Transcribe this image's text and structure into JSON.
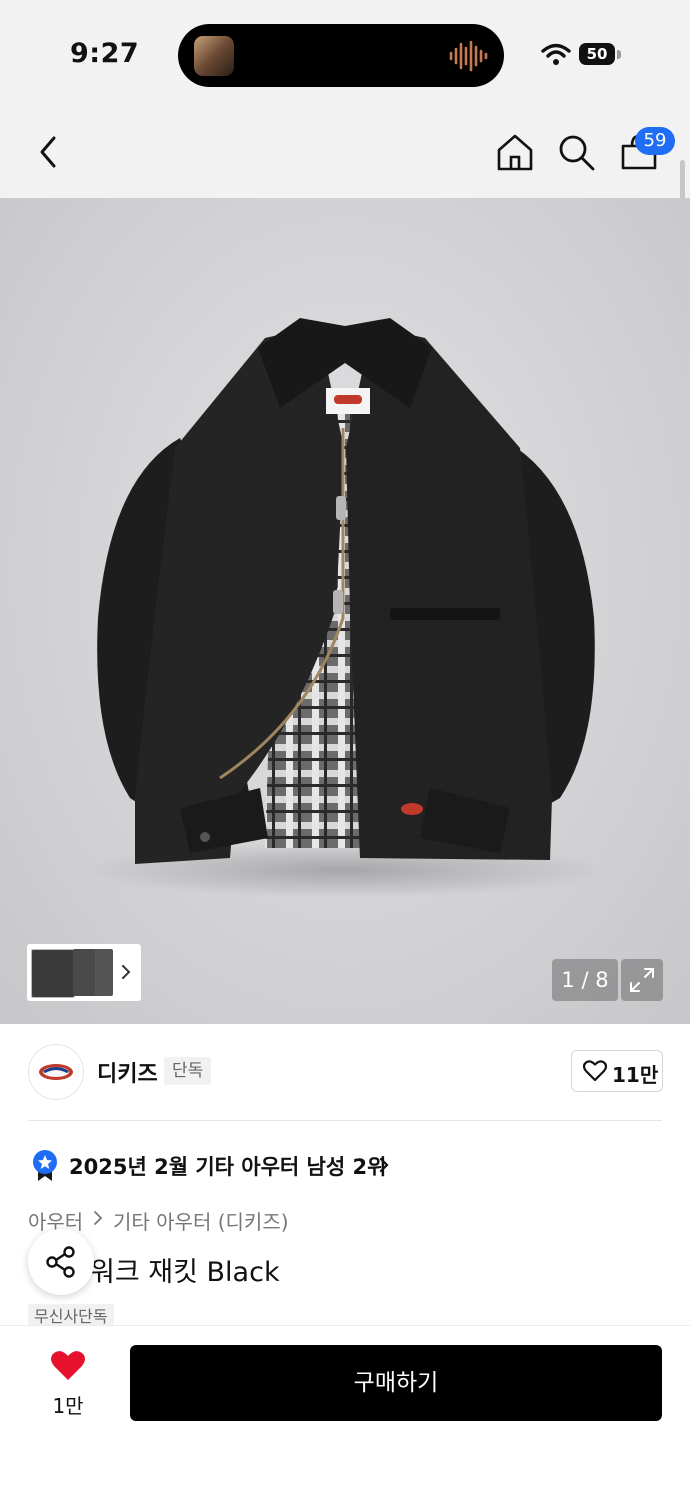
{
  "status_bar": {
    "time": "9:27",
    "battery": "50"
  },
  "nav": {
    "cart_count": "59"
  },
  "gallery": {
    "pager": "1 / 8"
  },
  "brand": {
    "name": "디키즈",
    "badge": "단독",
    "like_count": "11만"
  },
  "ranking": {
    "text": "2025년 2월 기타 아우터 남성 2위"
  },
  "breadcrumb": {
    "level1": "아우터",
    "level2": "기타 아우터 (디키즈)"
  },
  "product": {
    "title": "워크 재킷 Black",
    "tag": "무신사단독"
  },
  "bottom": {
    "wish_count": "1만",
    "buy_label": "구매하기"
  },
  "colors": {
    "accent_blue": "#1f6cf5",
    "heart_red": "#e8112d",
    "buy_bg": "#000000"
  },
  "icons": [
    "back-icon",
    "home-icon",
    "search-icon",
    "cart-icon",
    "expand-icon",
    "heart-icon",
    "rank-medal-icon",
    "chevron-right-icon",
    "share-icon"
  ]
}
